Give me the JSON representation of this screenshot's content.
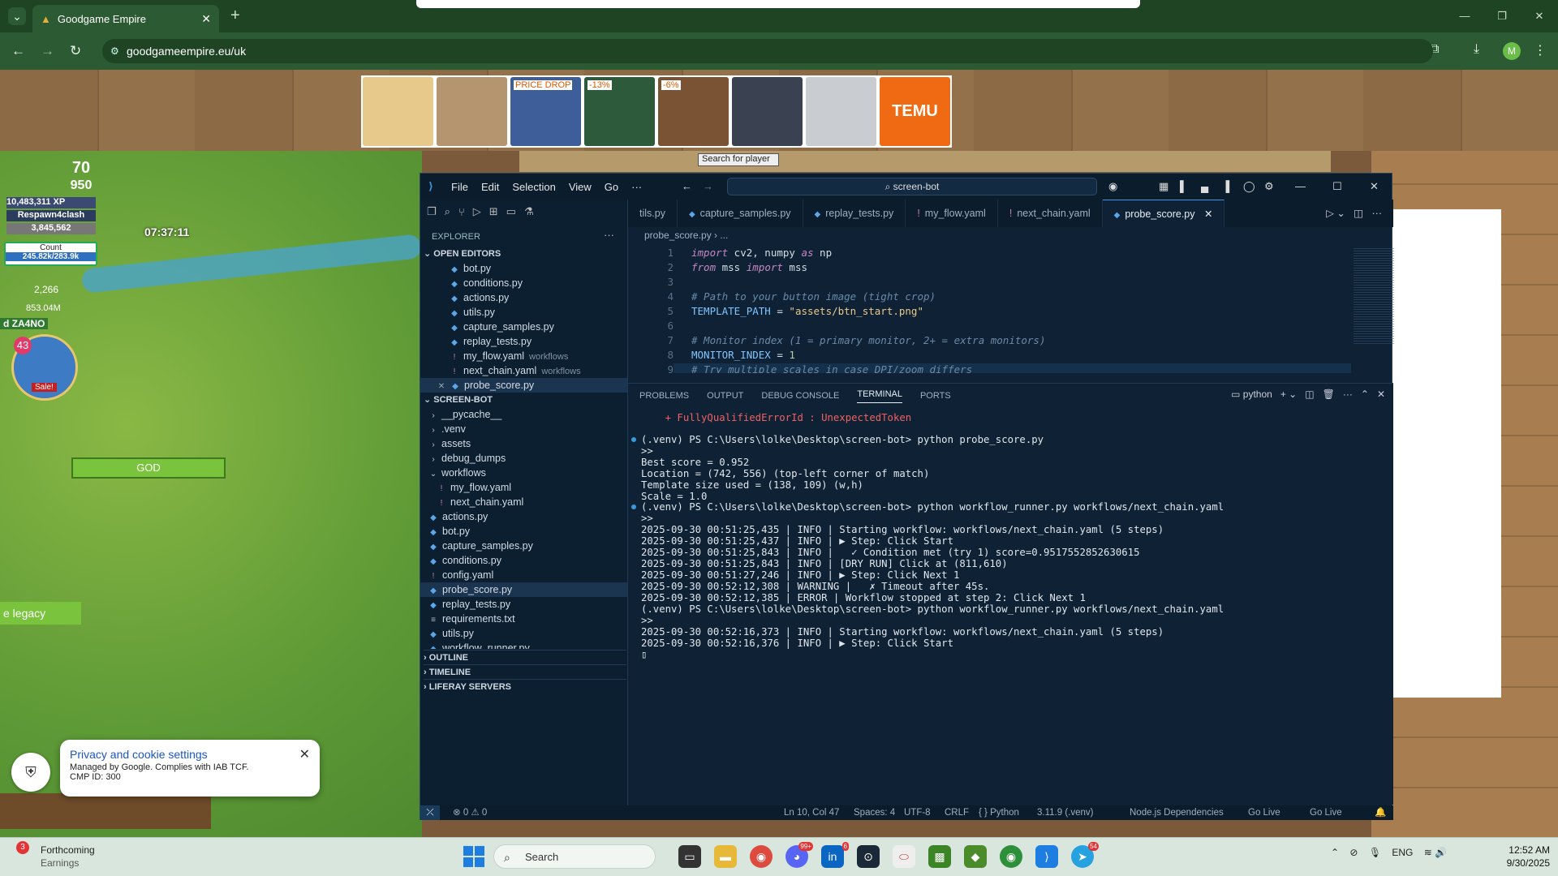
{
  "browser": {
    "tab_title": "Goodgame Empire",
    "url": "goodgameempire.eu/uk",
    "avatar_initial": "M"
  },
  "ads": {
    "price_drop": "PRICE DROP",
    "discount_1": "-13%",
    "discount_2": "-6%",
    "temu": "TEMU"
  },
  "game": {
    "search_player_placeholder": "Search for player",
    "level": "70",
    "level_sub": "950",
    "xp": "10,483,311 XP",
    "player": "Respawn4clash",
    "gold": "3,845,562",
    "count_label": "Count",
    "count_value": "245.82k/283.9k",
    "res1": "2,266",
    "res2": "853.04M",
    "timer": "07:37:11",
    "alliance_tag": "d ZA4NO",
    "sale_count": "43",
    "sale_label": "Sale!",
    "castle_name": "GOD",
    "legacy_label": "e legacy"
  },
  "cookie": {
    "title": "Privacy and cookie settings",
    "line1": "Managed by Google. Complies with IAB TCF.",
    "line2": "CMP ID: 300"
  },
  "vscode": {
    "menus": [
      "File",
      "Edit",
      "Selection",
      "View",
      "Go",
      "···"
    ],
    "search": "screen-bot",
    "explorer_label": "EXPLORER",
    "open_editors_label": "OPEN EDITORS",
    "open_editors": [
      {
        "name": "bot.py",
        "desc": ""
      },
      {
        "name": "conditions.py",
        "desc": ""
      },
      {
        "name": "actions.py",
        "desc": ""
      },
      {
        "name": "utils.py",
        "desc": ""
      },
      {
        "name": "capture_samples.py",
        "desc": ""
      },
      {
        "name": "replay_tests.py",
        "desc": ""
      },
      {
        "name": "my_flow.yaml",
        "desc": "workflows"
      },
      {
        "name": "next_chain.yaml",
        "desc": "workflows"
      },
      {
        "name": "probe_score.py",
        "desc": ""
      }
    ],
    "project_label": "SCREEN-BOT",
    "tree": [
      "__pycache__",
      ".venv",
      "assets",
      "debug_dumps",
      "workflows",
      "my_flow.yaml",
      "next_chain.yaml",
      "actions.py",
      "bot.py",
      "capture_samples.py",
      "conditions.py",
      "config.yaml",
      "probe_score.py",
      "replay_tests.py",
      "requirements.txt",
      "utils.py",
      "workflow_runner.py"
    ],
    "outline_label": "OUTLINE",
    "timeline_label": "TIMELINE",
    "liferay_label": "LIFERAY SERVERS",
    "tabs": [
      "tils.py",
      "capture_samples.py",
      "replay_tests.py",
      "my_flow.yaml",
      "next_chain.yaml",
      "probe_score.py"
    ],
    "breadcrumb": "probe_score.py › ...",
    "panel_tabs": [
      "PROBLEMS",
      "OUTPUT",
      "DEBUG CONSOLE",
      "TERMINAL",
      "PORTS"
    ],
    "terminal_shell": "python",
    "terminal_lines": [
      "    + FullyQualifiedErrorId : UnexpectedToken",
      "",
      "(.venv) PS C:\\Users\\lolke\\Desktop\\screen-bot> python probe_score.py",
      ">>",
      "Best score = 0.952",
      "Location = (742, 556) (top-left corner of match)",
      "Template size used = (138, 109) (w,h)",
      "Scale = 1.0",
      "(.venv) PS C:\\Users\\lolke\\Desktop\\screen-bot> python workflow_runner.py workflows/next_chain.yaml",
      ">>",
      "2025-09-30 00:51:25,435 | INFO | Starting workflow: workflows/next_chain.yaml (5 steps)",
      "2025-09-30 00:51:25,437 | INFO | ▶ Step: Click Start",
      "2025-09-30 00:51:25,843 | INFO |   ✓ Condition met (try 1) score=0.9517552852630615",
      "2025-09-30 00:51:25,843 | INFO | [DRY RUN] Click at (811,610)",
      "2025-09-30 00:51:27,246 | INFO | ▶ Step: Click Next 1",
      "2025-09-30 00:52:12,308 | WARNING |   ✗ Timeout after 45s.",
      "2025-09-30 00:52:12,385 | ERROR | Workflow stopped at step 2: Click Next 1",
      "(.venv) PS C:\\Users\\lolke\\Desktop\\screen-bot> python workflow_runner.py workflows/next_chain.yaml",
      ">>",
      "2025-09-30 00:52:16,373 | INFO | Starting workflow: workflows/next_chain.yaml (5 steps)",
      "2025-09-30 00:52:16,376 | INFO | ▶ Step: Click Start"
    ],
    "status": {
      "problems": "⊗ 0 ⚠ 0",
      "position": "Ln 10, Col 47",
      "spaces": "Spaces: 4",
      "encoding": "UTF-8",
      "eol": "CRLF",
      "language": "Python",
      "interpreter": "3.11.9 (.venv)",
      "node": "Node.js Dependencies",
      "golive1": "Go Live",
      "golive2": "Go Live"
    }
  },
  "taskbar": {
    "weather_title": "Forthcoming",
    "weather_sub": "Earnings",
    "weather_badge": "3",
    "search": "Search",
    "lang": "ENG",
    "time": "12:52 AM",
    "date": "9/30/2025",
    "discord_badge": "99+",
    "linkedin_badge": "6",
    "telegram_badge": "54"
  }
}
